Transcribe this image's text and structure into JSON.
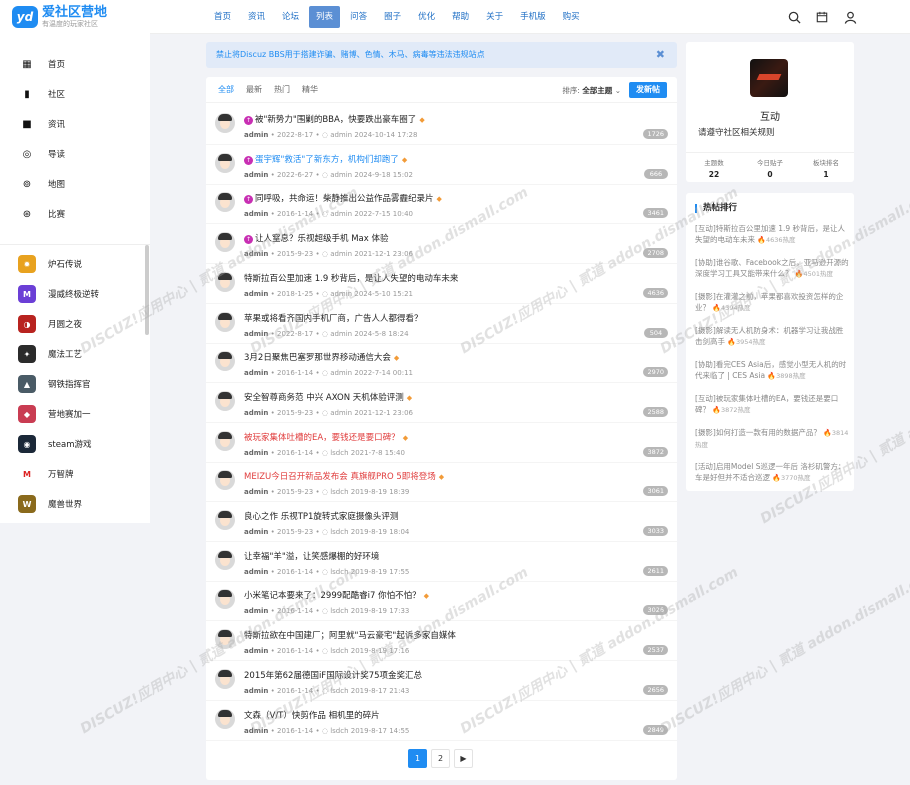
{
  "brand": {
    "title": "爱社区营地",
    "subtitle": "有温度的玩家社区",
    "logo_text": "yd"
  },
  "sidebar": {
    "items": [
      {
        "label": "首页",
        "icon": "grid-icon"
      },
      {
        "label": "社区",
        "icon": "bookmark-icon"
      },
      {
        "label": "资讯",
        "icon": "bag-icon"
      },
      {
        "label": "导读",
        "icon": "disc-icon"
      },
      {
        "label": "地图",
        "icon": "map-icon"
      },
      {
        "label": "比赛",
        "icon": "trophy-icon"
      }
    ],
    "games": [
      {
        "label": "炉石传说",
        "color": "#e8a21f",
        "glyph": "✹"
      },
      {
        "label": "漫威终极逆转",
        "color": "#6b3fd6",
        "glyph": "M"
      },
      {
        "label": "月圆之夜",
        "color": "#b8231f",
        "glyph": "◑"
      },
      {
        "label": "魔法工艺",
        "color": "#2b2b2b",
        "glyph": "✦"
      },
      {
        "label": "钢铁指挥官",
        "color": "#4a5b66",
        "glyph": "▲"
      },
      {
        "label": "营地赛加一",
        "color": "#c93c52",
        "glyph": "◆"
      },
      {
        "label": "steam游戏",
        "color": "#1b2838",
        "glyph": "◉"
      },
      {
        "label": "万智牌",
        "color": "#ffffff",
        "glyph": "M"
      },
      {
        "label": "魔兽世界",
        "color": "#8a6a1c",
        "glyph": "W"
      }
    ]
  },
  "topnav": [
    {
      "label": "首页",
      "active": false
    },
    {
      "label": "资讯",
      "active": false
    },
    {
      "label": "论坛",
      "active": false
    },
    {
      "label": "列表",
      "active": true
    },
    {
      "label": "问答",
      "active": false
    },
    {
      "label": "圈子",
      "active": false
    },
    {
      "label": "优化",
      "active": false
    },
    {
      "label": "帮助",
      "active": false
    },
    {
      "label": "关于",
      "active": false
    },
    {
      "label": "手机版",
      "active": false
    },
    {
      "label": "购买",
      "active": false
    }
  ],
  "notice": {
    "text": "禁止将Discuz BBS用于搭建诈骗、赌博、色情、木马、病毒等违法违规站点",
    "close": "✖"
  },
  "tabs": [
    "全部",
    "最新",
    "热门",
    "精华"
  ],
  "sort": {
    "label": "排序:",
    "value": "全部主题",
    "post_button": "发新帖"
  },
  "threads": [
    {
      "title": "被\"新势力\"围剿的BBA，快要跌出豪车圈了",
      "color": "normal",
      "up": true,
      "gem": true,
      "author": "admin",
      "date": "2022-8-17",
      "last_user": "admin",
      "last_time": "2024-10-14 17:28",
      "count": "1726"
    },
    {
      "title": "蛋宇辉\"救活\"了新东方，机构们却跑了",
      "color": "blue",
      "up": true,
      "gem": true,
      "author": "admin",
      "date": "2022-6-27",
      "last_user": "admin",
      "last_time": "2024-9-18 15:02",
      "count": "666"
    },
    {
      "title": "同呼吸，共命运！柴静推出公益作品雾霾纪录片",
      "color": "normal",
      "up": true,
      "gem": true,
      "author": "admin",
      "date": "2016-1-14",
      "last_user": "admin",
      "last_time": "2022-7-15 10:40",
      "count": "3461"
    },
    {
      "title": "让人窒息？乐视超级手机 Max 体验",
      "color": "normal",
      "up": true,
      "gem": false,
      "author": "admin",
      "date": "2015-9-23",
      "last_user": "admin",
      "last_time": "2021-12-1 23:06",
      "count": "2708"
    },
    {
      "title": "特斯拉百公里加速 1.9 秒背后，是让人失望的电动车未来",
      "color": "normal",
      "up": false,
      "gem": false,
      "author": "admin",
      "date": "2018-1-25",
      "last_user": "admin",
      "last_time": "2024-5-10 15:21",
      "count": "4636"
    },
    {
      "title": "苹果或将看齐国内手机厂商，广告人人都得看？",
      "color": "normal",
      "up": false,
      "gem": false,
      "author": "admin",
      "date": "2022-8-17",
      "last_user": "admin",
      "last_time": "2024-5-8 18:24",
      "count": "504"
    },
    {
      "title": "3月2日聚焦巴塞罗那世界移动通信大会",
      "color": "normal",
      "up": false,
      "gem": true,
      "author": "admin",
      "date": "2016-1-14",
      "last_user": "admin",
      "last_time": "2022-7-14 00:11",
      "count": "2970"
    },
    {
      "title": "安全智尊商务范 中兴 AXON 天机体验评测",
      "color": "normal",
      "up": false,
      "gem": true,
      "author": "admin",
      "date": "2015-9-23",
      "last_user": "admin",
      "last_time": "2021-12-1 23:06",
      "count": "2588"
    },
    {
      "title": "被玩家集体吐槽的EA，要钱还是要口碑？",
      "color": "red",
      "up": false,
      "gem": true,
      "author": "admin",
      "date": "2016-1-14",
      "last_user": "lsdch",
      "last_time": "2021-7-8 15:40",
      "count": "3872"
    },
    {
      "title": "MEIZU今日召开新品发布会 真旗舰PRO 5即将登场",
      "color": "red",
      "up": false,
      "gem": true,
      "author": "admin",
      "date": "2015-9-23",
      "last_user": "lsdch",
      "last_time": "2019-8-19 18:39",
      "count": "3061"
    },
    {
      "title": "良心之作 乐视TP1旋转式家庭摄像头评测",
      "color": "normal",
      "up": false,
      "gem": false,
      "author": "admin",
      "date": "2015-9-23",
      "last_user": "lsdch",
      "last_time": "2019-8-19 18:04",
      "count": "3033"
    },
    {
      "title": "让幸福\"羊\"溢，让笑感爆棚的好环境",
      "color": "normal",
      "up": false,
      "gem": false,
      "author": "admin",
      "date": "2016-1-14",
      "last_user": "lsdch",
      "last_time": "2019-8-19 17:55",
      "count": "2611"
    },
    {
      "title": "小米笔记本要来了：2999配酷睿i7 你怕不怕？",
      "color": "normal",
      "up": false,
      "gem": true,
      "author": "admin",
      "date": "2016-1-14",
      "last_user": "lsdch",
      "last_time": "2019-8-19 17:33",
      "count": "3026"
    },
    {
      "title": "特斯拉欲在中国建厂；阿里就\"马云豪宅\"起诉多家自媒体",
      "color": "normal",
      "up": false,
      "gem": false,
      "author": "admin",
      "date": "2016-1-14",
      "last_user": "lsdch",
      "last_time": "2019-8-19 17:16",
      "count": "2537"
    },
    {
      "title": "2015年第62届德国iF国际设计奖75项金奖汇总",
      "color": "normal",
      "up": false,
      "gem": false,
      "author": "admin",
      "date": "2016-1-14",
      "last_user": "lsdch",
      "last_time": "2019-8-17 21:43",
      "count": "2656"
    },
    {
      "title": "文森（V/T）快剪作品 相机里的碎片",
      "color": "normal",
      "up": false,
      "gem": false,
      "author": "admin",
      "date": "2016-1-14",
      "last_user": "lsdch",
      "last_time": "2019-8-17 14:55",
      "count": "2849"
    }
  ],
  "pager": {
    "pages": [
      "1",
      "2"
    ],
    "next": "▶"
  },
  "user_card": {
    "name": "互动",
    "rule": "请遵守社区相关规则",
    "stats": [
      {
        "k": "主题数",
        "v": "22"
      },
      {
        "k": "今日贴子",
        "v": "0"
      },
      {
        "k": "板块排名",
        "v": "1"
      }
    ]
  },
  "hot": {
    "title": "热帖排行",
    "items": [
      {
        "text": "[互动]特斯拉百公里加速 1.9 秒背后，是让人失望的电动车未来",
        "heat": "4636热度"
      },
      {
        "text": "[协助]谁谷歌、Facebook之后，亚马逊开源的深度学习工具又能带来什么？",
        "heat": "4501热度"
      },
      {
        "text": "[摄影]在灌灌之前，苹果都喜欢投资怎样的企业？",
        "heat": "4394热度"
      },
      {
        "text": "[摄影]解读无人机防身术：机器学习让我战胜击剑高手",
        "heat": "3954热度"
      },
      {
        "text": "[协助]看完CES Asia后，感觉小型无人机的时代来临了 | CES Asia",
        "heat": "3898热度"
      },
      {
        "text": "[互动]被玩家集体吐槽的EA，要钱还是要口碑？",
        "heat": "3872热度"
      },
      {
        "text": "[摄影]如何打造一款有用的数据产品？",
        "heat": "3814热度"
      },
      {
        "text": "[活动]启用Model S巡逻一年后 洛杉矶警方：车是好但并不适合巡逻",
        "heat": "3770热度"
      }
    ]
  },
  "watermark": "DISCUZ!应用中心 | 贰道 addon.dismall.com"
}
